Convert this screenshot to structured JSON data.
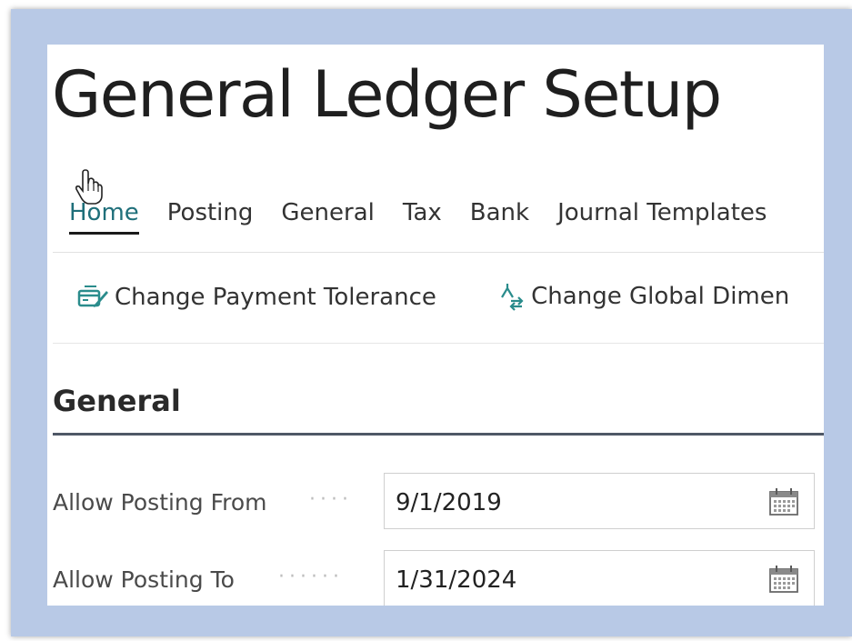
{
  "page": {
    "title": "General Ledger Setup"
  },
  "tabs": [
    {
      "label": "Home",
      "active": true
    },
    {
      "label": "Posting"
    },
    {
      "label": "General"
    },
    {
      "label": "Tax"
    },
    {
      "label": "Bank"
    },
    {
      "label": "Journal Templates"
    }
  ],
  "actions": [
    {
      "label": "Change Payment Tolerance",
      "icon": "payment-tolerance-icon"
    },
    {
      "label": "Change Global Dimen",
      "icon": "global-dimensions-icon"
    }
  ],
  "section": {
    "title": "General"
  },
  "fields": [
    {
      "label": "Allow Posting From",
      "value": "9/1/2019",
      "icon": "calendar-icon"
    },
    {
      "label": "Allow Posting To",
      "value": "1/31/2024",
      "icon": "calendar-icon"
    }
  ],
  "colors": {
    "frame": "#b8c9e6",
    "active_tab": "#1f6f7a",
    "section_line": "#4f5866",
    "action_icon": "#2a8c8c"
  }
}
